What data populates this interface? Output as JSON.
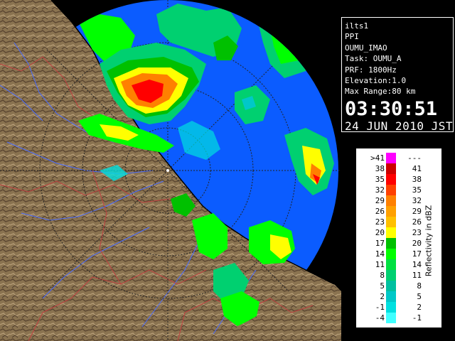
{
  "info": {
    "station": "ilts1",
    "mode": "PPI",
    "product": "OUMU_IMAO",
    "task": "Task: OUMU_A",
    "prf": "PRF: 1800Hz",
    "elevation": "Elevation:1.0",
    "max_range": "Max Range:80 km",
    "time": "03:30:51",
    "date": "24 JUN 2010 JST"
  },
  "legend": {
    "axis_label": "Reflectivity in dBZ",
    "rows": [
      {
        "lo": ">41",
        "hi": "---",
        "color": "#ff00ff"
      },
      {
        "lo": "38",
        "hi": "41",
        "color": "#cc0000"
      },
      {
        "lo": "35",
        "hi": "38",
        "color": "#ff0000"
      },
      {
        "lo": "32",
        "hi": "35",
        "color": "#ff4000"
      },
      {
        "lo": "29",
        "hi": "32",
        "color": "#ff8000"
      },
      {
        "lo": "26",
        "hi": "29",
        "color": "#ffa000"
      },
      {
        "lo": "23",
        "hi": "26",
        "color": "#ffc000"
      },
      {
        "lo": "20",
        "hi": "23",
        "color": "#ffff00"
      },
      {
        "lo": "17",
        "hi": "20",
        "color": "#00c000"
      },
      {
        "lo": "14",
        "hi": "17",
        "color": "#00ff00"
      },
      {
        "lo": "11",
        "hi": "14",
        "color": "#00e040"
      },
      {
        "lo": "8",
        "hi": "11",
        "color": "#00d070"
      },
      {
        "lo": "5",
        "hi": "8",
        "color": "#00c0a0"
      },
      {
        "lo": "2",
        "hi": "5",
        "color": "#00c8c8"
      },
      {
        "lo": "-1",
        "hi": "2",
        "color": "#00e0e0"
      },
      {
        "lo": "-4",
        "hi": "-1",
        "color": "#40ffff"
      }
    ]
  },
  "colors": {
    "sea": "#0b5cff",
    "outside_range": "#1133cc",
    "land": "#8a7350",
    "river": "#4a6cff",
    "boundary": "#c04040"
  }
}
